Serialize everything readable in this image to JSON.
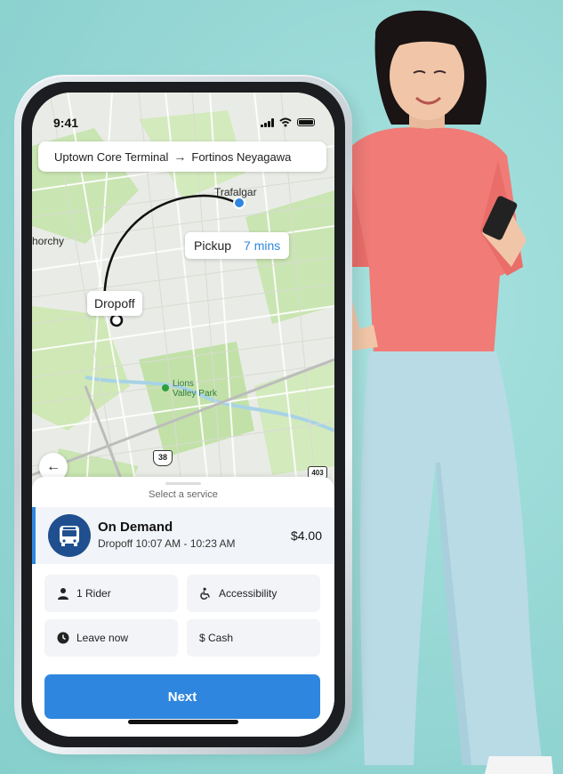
{
  "status_bar": {
    "time": "9:41"
  },
  "route": {
    "from": "Uptown Core Terminal",
    "to": "Fortinos Neyagawa"
  },
  "map": {
    "labels": {
      "trafalgar": "Trafalgar",
      "horchy": "horchy",
      "park_line1": "Lions",
      "park_line2": "Valley Park",
      "highway_38": "38",
      "highway_403": "403"
    },
    "pickup": {
      "label": "Pickup",
      "eta": "7 mins"
    },
    "dropoff": {
      "label": "Dropoff"
    }
  },
  "sheet": {
    "title": "Select a service",
    "service": {
      "name": "On Demand",
      "subtitle": "Dropoff 10:07 AM - 10:23 AM",
      "price": "$4.00",
      "icon_text": "On Demand"
    },
    "options": {
      "riders": "1 Rider",
      "accessibility": "Accessibility",
      "departure": "Leave now",
      "payment": "$ Cash"
    },
    "next_label": "Next"
  },
  "colors": {
    "accent": "#2e86de",
    "background": "#9fdcd9",
    "shirt": "#f07b77",
    "jeans": "#b9dbe6"
  }
}
